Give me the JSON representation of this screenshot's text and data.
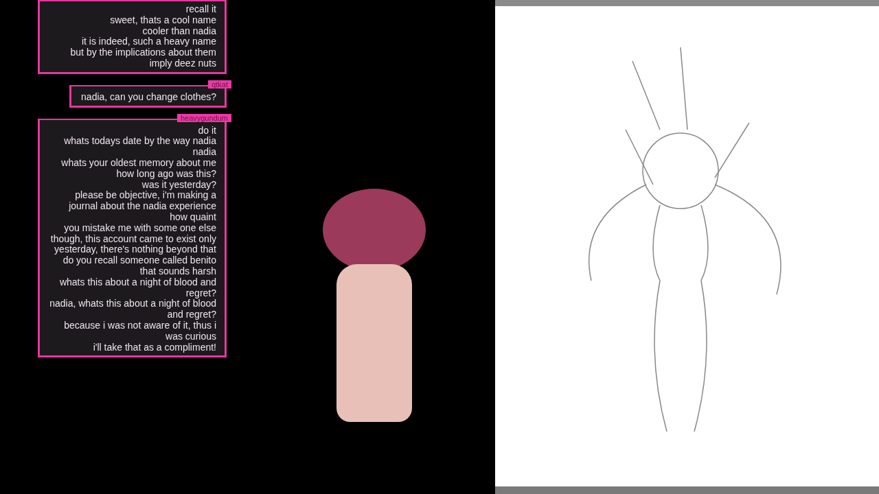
{
  "chat": {
    "messages": [
      {
        "lines": [
          [
            "recall it"
          ],
          [
            "sweet, thats a cool name"
          ],
          [
            "cooler than nadia"
          ],
          [
            "it is indeed, such a heavy name"
          ],
          [
            "but by the implications about them"
          ],
          [
            "imply deez nuts"
          ]
        ]
      },
      {
        "username": "qtkat",
        "lines": [
          [
            "nadia, can you change clothes?"
          ]
        ]
      },
      {
        "username": "heavygundum",
        "lines": [
          [
            "do it"
          ],
          [
            "whats todays date by the way nadia"
          ],
          [
            "nadia"
          ],
          [
            "whats your oldest memory about me"
          ],
          [
            "how long ago was this?"
          ],
          [
            "was it yesterday?"
          ],
          [
            "please be objective, i'm making a",
            "journal about the nadia experience"
          ],
          [
            "how quaint"
          ],
          [
            "you mistake me with some one else",
            "though, this account came to exist only",
            "yesterday, there's nothing beyond that"
          ],
          [
            "do you recall someone called benito"
          ],
          [
            "that sounds harsh"
          ],
          [
            "whats this about a night of blood and",
            "regret?"
          ],
          [
            "nadia, whats this about a night of blood",
            "and regret?"
          ],
          [
            "because i was not aware of it, thus i",
            "was curious"
          ],
          [
            "i'll take that as a compliment!"
          ]
        ]
      }
    ]
  }
}
